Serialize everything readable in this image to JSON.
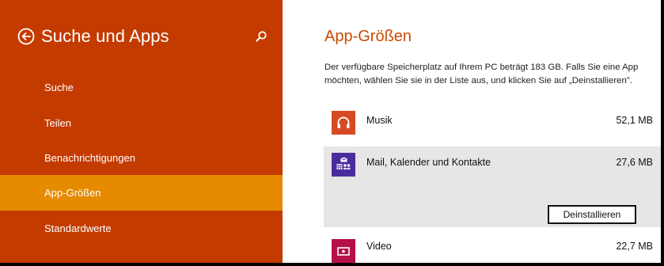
{
  "sidebar": {
    "title": "Suche und Apps",
    "items": [
      {
        "label": "Suche"
      },
      {
        "label": "Teilen"
      },
      {
        "label": "Benachrichtigungen"
      },
      {
        "label": "App-Größen",
        "active": true
      },
      {
        "label": "Standardwerte"
      }
    ]
  },
  "main": {
    "title": "App-Größen",
    "description_line1": "Der verfügbare Speicherplatz auf Ihrem PC beträgt 183 GB. Falls Sie eine App",
    "description_line2": "möchten, wählen Sie sie in der Liste aus, und klicken Sie auf „Deinstallieren\".",
    "apps": [
      {
        "name": "Musik",
        "size": "52,1 MB",
        "icon": "headphones-icon",
        "color": "#d64b25"
      },
      {
        "name": "Mail, Kalender und Kontakte",
        "size": "27,6 MB",
        "icon": "mail-calendar-people-icon",
        "color": "#4b2c9c",
        "selected": true
      },
      {
        "name": "Video",
        "size": "22,7 MB",
        "icon": "video-icon",
        "color": "#b5114a"
      }
    ],
    "uninstall_label": "Deinstallieren"
  },
  "colors": {
    "sidebar_bg": "#c43b00",
    "active_item_bg": "#e68a00",
    "title_accent": "#cc4a00",
    "selected_row_bg": "#e6e6e6"
  }
}
